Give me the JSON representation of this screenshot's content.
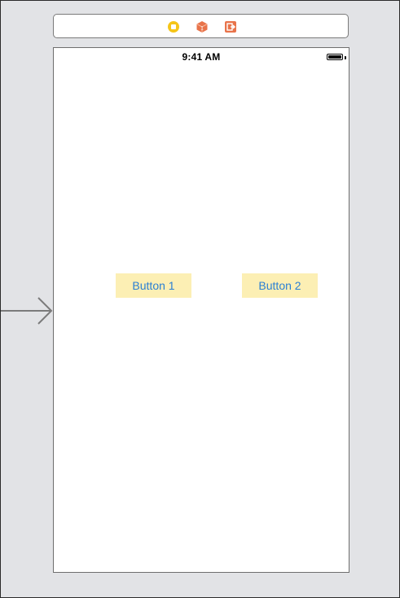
{
  "scene_dock": {
    "icons": [
      "view-controller-icon",
      "first-responder-icon",
      "exit-icon"
    ],
    "colors": {
      "view_controller": "#f5c518",
      "first_responder": "#e8734a",
      "exit": "#e8734a"
    }
  },
  "device": {
    "status_bar": {
      "time": "9:41 AM",
      "battery_icon": "battery-full-icon"
    },
    "buttons": [
      {
        "label": "Button 1"
      },
      {
        "label": "Button 2"
      }
    ],
    "colors": {
      "button_background": "#fcefb4",
      "button_text": "#2a7fd4"
    }
  },
  "entry_point": {
    "icon": "initial-view-controller-arrow-icon"
  }
}
